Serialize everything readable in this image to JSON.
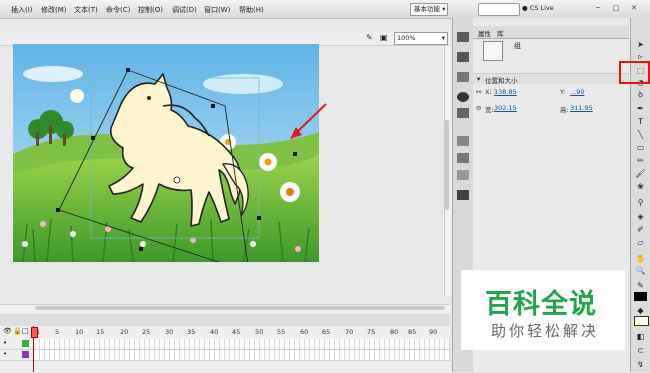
{
  "menubar": {
    "items": [
      "插入(I)",
      "修改(M)",
      "文本(T)",
      "命令(C)",
      "控制(O)",
      "调试(D)",
      "窗口(W)",
      "帮助(H)"
    ],
    "workspace": "基本功能",
    "cs_live": "CS Live",
    "window_buttons": [
      "─",
      "□",
      "✕"
    ]
  },
  "stage": {
    "zoom": "100%"
  },
  "timeline": {
    "frame_numbers": [
      "1",
      "5",
      "10",
      "15",
      "20",
      "25",
      "30",
      "35",
      "40",
      "45",
      "50",
      "55",
      "60",
      "65",
      "70",
      "75",
      "80",
      "85",
      "90"
    ]
  },
  "properties": {
    "tabs": [
      "属性",
      "库"
    ],
    "object_type": "组",
    "section": "位置和大小",
    "x_label": "X:",
    "x_value": "138.85",
    "y_label": "Y:",
    "y_value": "...90",
    "w_label": "宽:",
    "w_value": "302.15",
    "h_label": "高:",
    "h_value": "311.95"
  },
  "watermark": {
    "title": "百科全说",
    "subtitle": "助你轻松解决"
  },
  "colors": {
    "sky": "#7fc3ea",
    "grass": "#5cb83a",
    "horse": "#fdf6cf",
    "annotation": "#e11b1b",
    "watermark_green": "#23a64a"
  }
}
